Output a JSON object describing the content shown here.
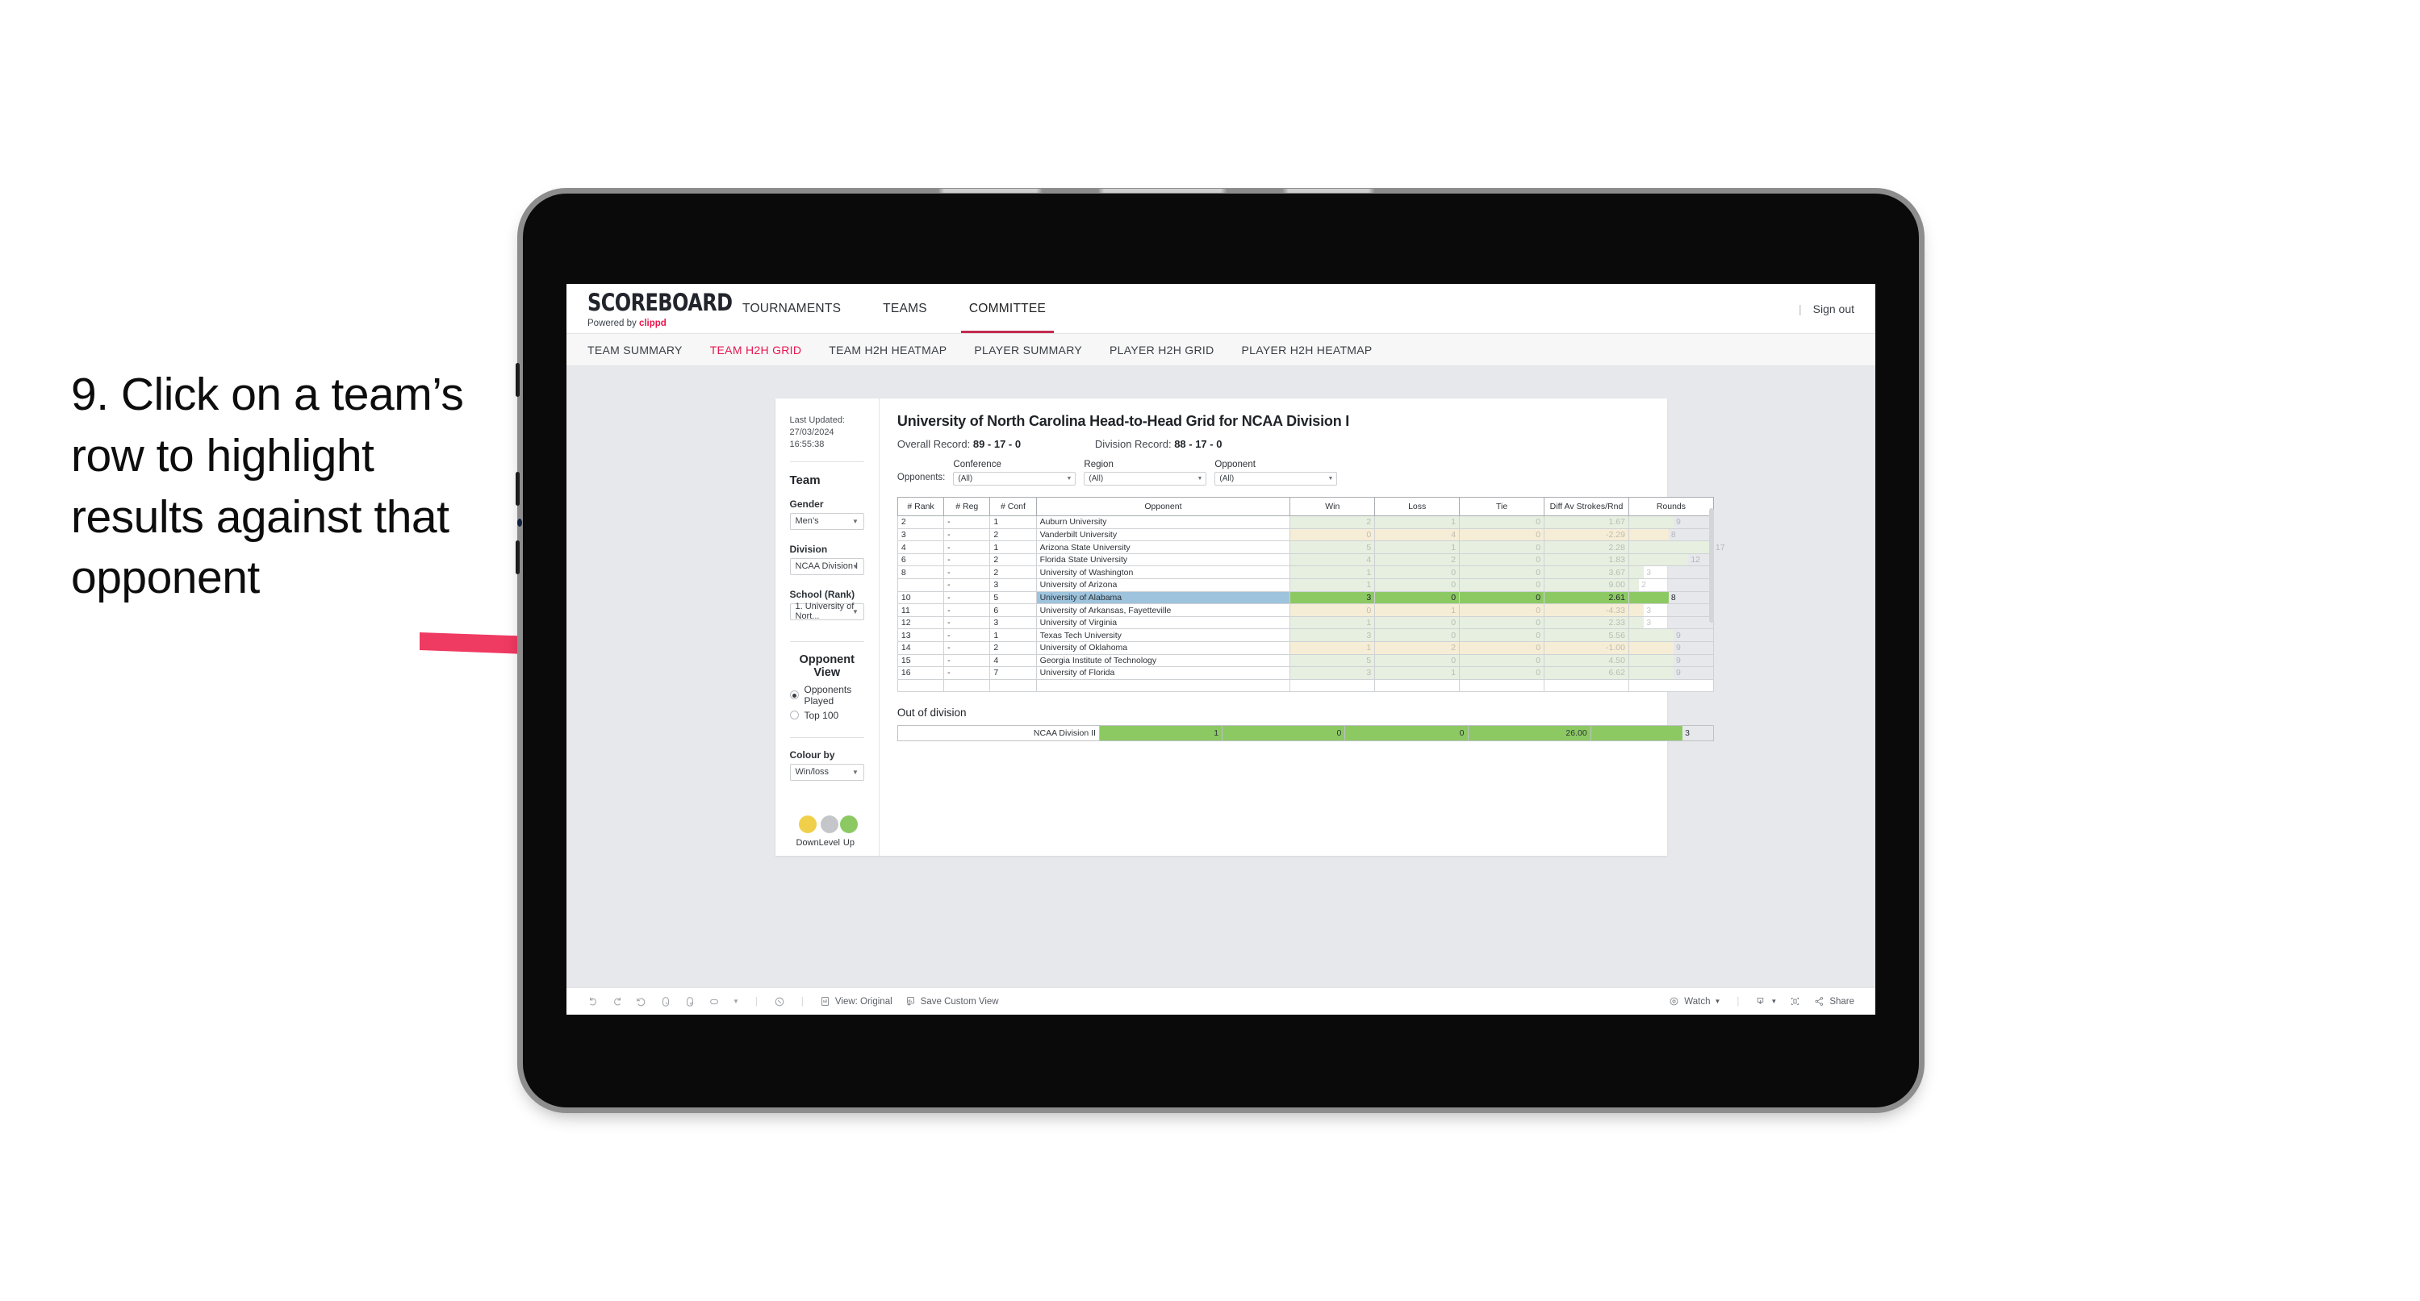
{
  "annotation": {
    "text": "9. Click on a team’s row to highlight results against that opponent",
    "arrow_color": "#ef3a62"
  },
  "app": {
    "brand": {
      "title": "SCOREBOARD",
      "powered_prefix": "Powered by ",
      "powered_brand": "clippd"
    },
    "nav": [
      {
        "label": "TOURNAMENTS",
        "active": false
      },
      {
        "label": "TEAMS",
        "active": false
      },
      {
        "label": "COMMITTEE",
        "active": true
      }
    ],
    "top_right": {
      "divider": "|",
      "sign_out": "Sign out"
    },
    "subnav": [
      {
        "label": "TEAM SUMMARY",
        "active": false
      },
      {
        "label": "TEAM H2H GRID",
        "active": true
      },
      {
        "label": "TEAM H2H HEATMAP",
        "active": false
      },
      {
        "label": "PLAYER SUMMARY",
        "active": false
      },
      {
        "label": "PLAYER H2H GRID",
        "active": false
      },
      {
        "label": "PLAYER H2H HEATMAP",
        "active": false
      }
    ],
    "accent_color": "#e8174e"
  },
  "sidebar": {
    "last_updated": "Last Updated: 27/03/2024 16:55:38",
    "team_heading": "Team",
    "gender_label": "Gender",
    "gender_value": "Men’s",
    "division_label": "Division",
    "division_value": "NCAA Division I",
    "school_label": "School (Rank)",
    "school_value": "1. University of Nort...",
    "opponent_view_heading": "Opponent View",
    "opponent_view_options": [
      {
        "label": "Opponents Played",
        "selected": true
      },
      {
        "label": "Top 100",
        "selected": false
      }
    ],
    "colour_by_label": "Colour by",
    "colour_by_value": "Win/loss",
    "legend": [
      {
        "label": "Down",
        "color": "#f0d04a"
      },
      {
        "label": "Level",
        "color": "#c4c6c9"
      },
      {
        "label": "Up",
        "color": "#8cc963"
      }
    ]
  },
  "report": {
    "title": "University of North Carolina Head-to-Head Grid for NCAA Division I",
    "overall_record_label": "Overall Record: ",
    "overall_record_value": "89 - 17 - 0",
    "division_record_label": "Division Record: ",
    "division_record_value": "88 - 17 - 0",
    "opponents_label": "Opponents:",
    "filters": [
      {
        "title": "Conference",
        "value": "(All)"
      },
      {
        "title": "Region",
        "value": "(All)"
      },
      {
        "title": "Opponent",
        "value": "(All)"
      }
    ],
    "columns": [
      "# Rank",
      "# Reg",
      "# Conf",
      "Opponent",
      "Win",
      "Loss",
      "Tie",
      "Diff Av Strokes/Rnd",
      "Rounds"
    ],
    "out_of_division_title": "Out of division",
    "out_of_division_row": {
      "label": "NCAA Division II",
      "win": "1",
      "loss": "0",
      "tie": "0",
      "diff": "26.00",
      "rounds": "3"
    }
  },
  "chart_data": {
    "type": "table",
    "title": "University of North Carolina Head-to-Head Grid for NCAA Division I",
    "columns": [
      "# Rank",
      "# Reg",
      "# Conf",
      "Opponent",
      "Win",
      "Loss",
      "Tie",
      "Diff Av Strokes/Rnd",
      "Rounds"
    ],
    "rounds_max": 17,
    "rows": [
      {
        "rank": "2",
        "reg": "-",
        "conf": "1",
        "opponent": "Auburn University",
        "win": "2",
        "loss": "1",
        "tie": "0",
        "diff": "1.67",
        "rounds": "9",
        "tone": "win",
        "selected": false
      },
      {
        "rank": "3",
        "reg": "-",
        "conf": "2",
        "opponent": "Vanderbilt University",
        "win": "0",
        "loss": "4",
        "tie": "0",
        "diff": "-2.29",
        "rounds": "8",
        "tone": "loss",
        "selected": false
      },
      {
        "rank": "4",
        "reg": "-",
        "conf": "1",
        "opponent": "Arizona State University",
        "win": "5",
        "loss": "1",
        "tie": "0",
        "diff": "2.28",
        "rounds": "17",
        "tone": "win",
        "selected": false
      },
      {
        "rank": "6",
        "reg": "-",
        "conf": "2",
        "opponent": "Florida State University",
        "win": "4",
        "loss": "2",
        "tie": "0",
        "diff": "1.83",
        "rounds": "12",
        "tone": "win",
        "selected": false
      },
      {
        "rank": "8",
        "reg": "-",
        "conf": "2",
        "opponent": "University of Washington",
        "win": "1",
        "loss": "0",
        "tie": "0",
        "diff": "3.67",
        "rounds": "3",
        "tone": "win",
        "selected": false
      },
      {
        "rank": "",
        "reg": "-",
        "conf": "3",
        "opponent": "University of Arizona",
        "win": "1",
        "loss": "0",
        "tie": "0",
        "diff": "9.00",
        "rounds": "2",
        "tone": "win",
        "selected": false
      },
      {
        "rank": "10",
        "reg": "-",
        "conf": "5",
        "opponent": "University of Alabama",
        "win": "3",
        "loss": "0",
        "tie": "0",
        "diff": "2.61",
        "rounds": "8",
        "tone": "win",
        "selected": true
      },
      {
        "rank": "11",
        "reg": "-",
        "conf": "6",
        "opponent": "University of Arkansas, Fayetteville",
        "win": "0",
        "loss": "1",
        "tie": "0",
        "diff": "-4.33",
        "rounds": "3",
        "tone": "loss",
        "selected": false
      },
      {
        "rank": "12",
        "reg": "-",
        "conf": "3",
        "opponent": "University of Virginia",
        "win": "1",
        "loss": "0",
        "tie": "0",
        "diff": "2.33",
        "rounds": "3",
        "tone": "win",
        "selected": false
      },
      {
        "rank": "13",
        "reg": "-",
        "conf": "1",
        "opponent": "Texas Tech University",
        "win": "3",
        "loss": "0",
        "tie": "0",
        "diff": "5.56",
        "rounds": "9",
        "tone": "win",
        "selected": false
      },
      {
        "rank": "14",
        "reg": "-",
        "conf": "2",
        "opponent": "University of Oklahoma",
        "win": "1",
        "loss": "2",
        "tie": "0",
        "diff": "-1.00",
        "rounds": "9",
        "tone": "loss",
        "selected": false
      },
      {
        "rank": "15",
        "reg": "-",
        "conf": "4",
        "opponent": "Georgia Institute of Technology",
        "win": "5",
        "loss": "0",
        "tie": "0",
        "diff": "4.50",
        "rounds": "9",
        "tone": "win",
        "selected": false
      },
      {
        "rank": "16",
        "reg": "-",
        "conf": "7",
        "opponent": "University of Florida",
        "win": "3",
        "loss": "1",
        "tie": "0",
        "diff": "6.62",
        "rounds": "9",
        "tone": "win",
        "selected": false
      }
    ]
  },
  "toolbar": {
    "view_label": "View: Original",
    "save_view_label": "Save Custom View",
    "watch_label": "Watch",
    "share_label": "Share"
  }
}
